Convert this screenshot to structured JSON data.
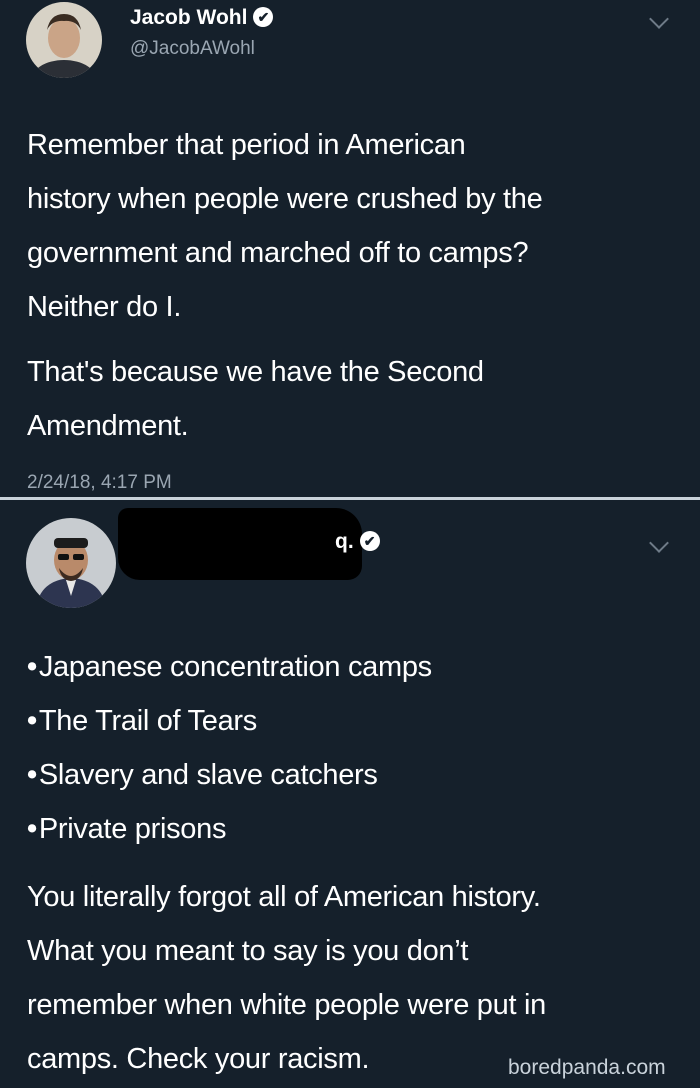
{
  "tweet1": {
    "display_name": "Jacob Wohl",
    "handle": "@JacobAWohl",
    "verified_glyph": "✔",
    "paragraph1_lines": [
      "Remember that period in American",
      "history when people were crushed by the",
      "government and marched off to camps?",
      "Neither do I."
    ],
    "paragraph2_lines": [
      "That's because we have the Second",
      "Amendment."
    ],
    "timestamp": "2/24/18, 4:17 PM"
  },
  "tweet2": {
    "display_name_partial": "q.",
    "verified_glyph": "✔",
    "list_items": [
      "Japanese concentration camps",
      "The Trail of Tears",
      "Slavery and slave catchers",
      "Private prisons"
    ],
    "bullet": "•",
    "paragraph_lines": [
      "You literally forgot all of American history.",
      "What you meant to say is you don’t",
      "remember when white people were put in",
      "camps. Check your racism."
    ]
  },
  "watermark": "boredpanda.com",
  "colors": {
    "background": "#15202b",
    "text": "#ffffff",
    "secondary_text": "#9aa6b2",
    "divider": "#c9d2da"
  },
  "icons": {
    "verified": "verified-badge-icon",
    "more": "chevron-down-icon"
  }
}
